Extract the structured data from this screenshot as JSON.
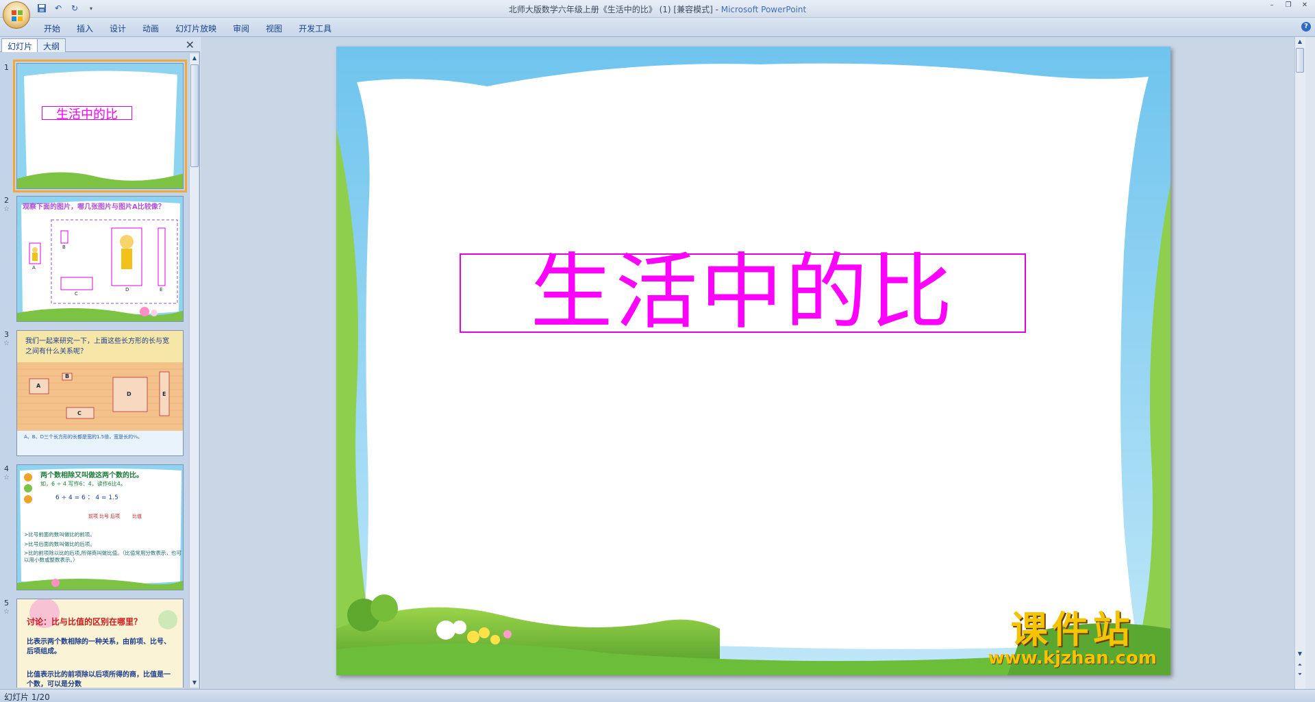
{
  "window": {
    "title": "北师大版数学六年级上册《生活中的比》 (1) [兼容模式] - ",
    "app_name": "Microsoft PowerPoint",
    "controls": [
      "–",
      "❐",
      "✕"
    ]
  },
  "quick_access": [
    "save-icon",
    "undo-icon",
    "redo-icon"
  ],
  "ribbon": {
    "tabs": [
      "开始",
      "插入",
      "设计",
      "动画",
      "幻灯片放映",
      "审阅",
      "视图",
      "开发工具"
    ]
  },
  "left_pane": {
    "tabs": [
      "幻灯片",
      "大纲"
    ],
    "close": "✕"
  },
  "thumbnails": [
    {
      "number": "1",
      "title": "生活中的比"
    },
    {
      "number": "2",
      "heading": "观察下面的图片，哪几张图片与图片A比较像？",
      "labels": [
        "A",
        "B",
        "C",
        "D",
        "E"
      ]
    },
    {
      "number": "3",
      "heading": "我们一起来研究一下，上面这些长方形的长与宽之间有什么关系呢？",
      "labels": [
        "A",
        "B",
        "C",
        "D",
        "E"
      ],
      "footer": "A、B、D三个长方形的长都是宽的1.5倍，宽是长的⅔。"
    },
    {
      "number": "4",
      "heading": "两个数相除又叫做这两个数的比。",
      "example": "如，6 ÷ 4  写作6：4，读作6比4。",
      "formula": "6 ÷ 4  = 6 ： 4 = 1.5",
      "parts": [
        "前项",
        "比号",
        "后项",
        "比值"
      ],
      "rules": [
        ">比号前面的数叫做比的前项。",
        ">比号后面的数叫做比的后项。",
        ">比的前项除以比的后项,所得商叫做比值。（比值常用分数表示，也可以用小数或整数表示。）"
      ]
    },
    {
      "number": "5",
      "heading": "讨论：比与比值的区别在哪里？",
      "line1": "比表示两个数相除的一种关系，由前项、比号、后项组成。",
      "line2": "比值表示比的前项除以后项所得的商，比值是一个数，可以是分数"
    }
  ],
  "slide": {
    "title": "生活中的比"
  },
  "watermark": {
    "cn": "课件站",
    "url": "www.kjzhan.com"
  },
  "status": {
    "text": "幻灯片 1/20"
  }
}
